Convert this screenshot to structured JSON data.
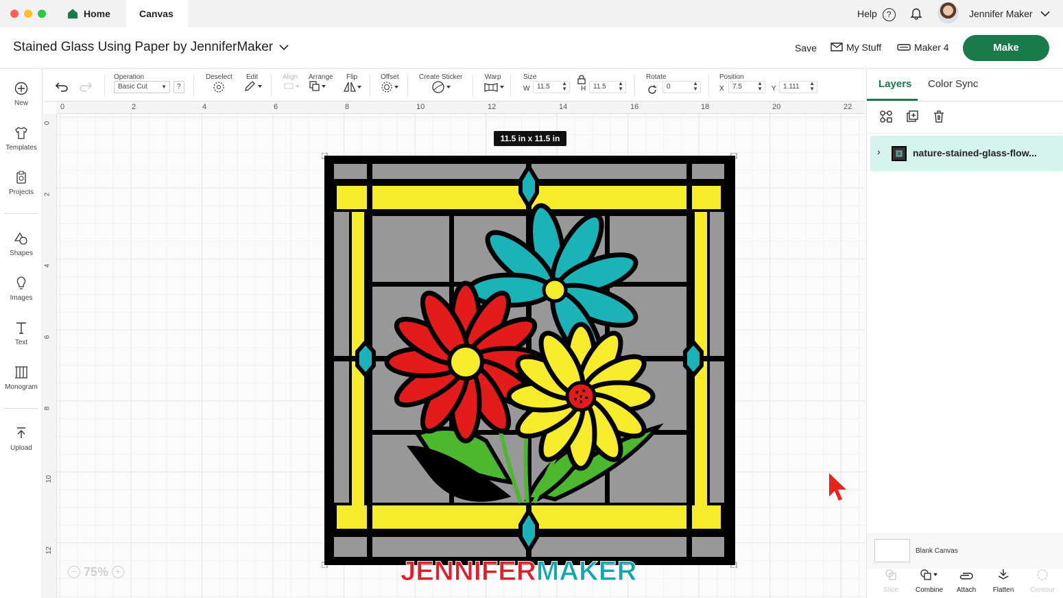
{
  "titlebar": {
    "tabs": [
      {
        "label": "Home"
      },
      {
        "label": "Canvas"
      }
    ],
    "help_label": "Help",
    "user_name": "Jennifer Maker"
  },
  "project": {
    "title": "Stained Glass Using Paper by JenniferMaker",
    "save_label": "Save",
    "mystuff_label": "My Stuff",
    "machine_label": "Maker 4",
    "make_label": "Make"
  },
  "toolbar": {
    "operation_label": "Operation",
    "operation_value": "Basic Cut",
    "operation_help": "?",
    "deselect_label": "Deselect",
    "edit_label": "Edit",
    "align_label": "Align",
    "arrange_label": "Arrange",
    "flip_label": "Flip",
    "offset_label": "Offset",
    "sticker_label": "Create Sticker",
    "warp_label": "Warp",
    "size_label": "Size",
    "w_label": "W",
    "w_value": "11.5",
    "h_label": "H",
    "h_value": "11.5",
    "rotate_label": "Rotate",
    "rotate_value": "0",
    "position_label": "Position",
    "x_label": "X",
    "x_value": "7.5",
    "y_label": "Y",
    "y_value": "1.111"
  },
  "leftrail": {
    "new": "New",
    "templates": "Templates",
    "projects": "Projects",
    "shapes": "Shapes",
    "images": "Images",
    "text": "Text",
    "monogram": "Monogram",
    "upload": "Upload"
  },
  "canvas": {
    "ruler_top": [
      "0",
      "2",
      "4",
      "6",
      "8",
      "10",
      "12",
      "14",
      "16",
      "18",
      "20",
      "22"
    ],
    "ruler_left": [
      "0",
      "2",
      "4",
      "6",
      "8",
      "10",
      "12"
    ],
    "size_tooltip": "11.5  in x 11.5  in",
    "zoom": "75%",
    "watermark_part1": "JENNIFER",
    "watermark_part2": "MAKER"
  },
  "rightpanel": {
    "tabs": [
      {
        "label": "Layers"
      },
      {
        "label": "Color Sync"
      }
    ],
    "layer_name": "nature-stained-glass-flow...",
    "blank_canvas_label": "Blank Canvas",
    "bottom_buttons": {
      "slice": "Slice",
      "combine": "Combine",
      "attach": "Attach",
      "flatten": "Flatten",
      "contour": "Contour"
    }
  },
  "colors": {
    "make_button": "#1a7a4a",
    "layers_accent": "#1a7a4a",
    "layer_selected_bg": "#d6f3ee",
    "glass_gray": "#9a9a9d",
    "lead_black": "#000000",
    "yellow": "#f7ec2c",
    "teal": "#19b3b8",
    "red": "#e31b1b",
    "green": "#4cb82d",
    "watermark_red": "#e11d2a",
    "watermark_teal": "#11a7b0"
  }
}
